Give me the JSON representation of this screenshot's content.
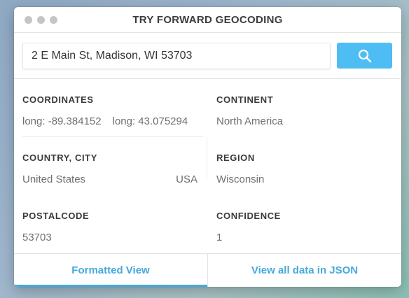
{
  "window": {
    "title": "TRY FORWARD GEOCODING"
  },
  "search": {
    "value": "2 E Main St, Madison, WI 53703",
    "button_icon": "search-icon",
    "button_color": "#4ebdf3"
  },
  "results": {
    "coordinates": {
      "label": "COORDINATES",
      "long": "long: -89.384152",
      "lat": "long: 43.075294"
    },
    "continent": {
      "label": "CONTINENT",
      "value": "North America"
    },
    "country_city": {
      "label": "COUNTRY, CITY",
      "country": "United States",
      "code": "USA"
    },
    "region": {
      "label": "REGION",
      "value": "Wisconsin"
    },
    "postalcode": {
      "label": "POSTALCODE",
      "value": "53703"
    },
    "confidence": {
      "label": "CONFIDENCE",
      "value": "1"
    }
  },
  "tabs": [
    {
      "label": "Formatted View",
      "active": true
    },
    {
      "label": "View all data in JSON",
      "active": false
    }
  ],
  "colors": {
    "accent": "#45a9dc"
  }
}
